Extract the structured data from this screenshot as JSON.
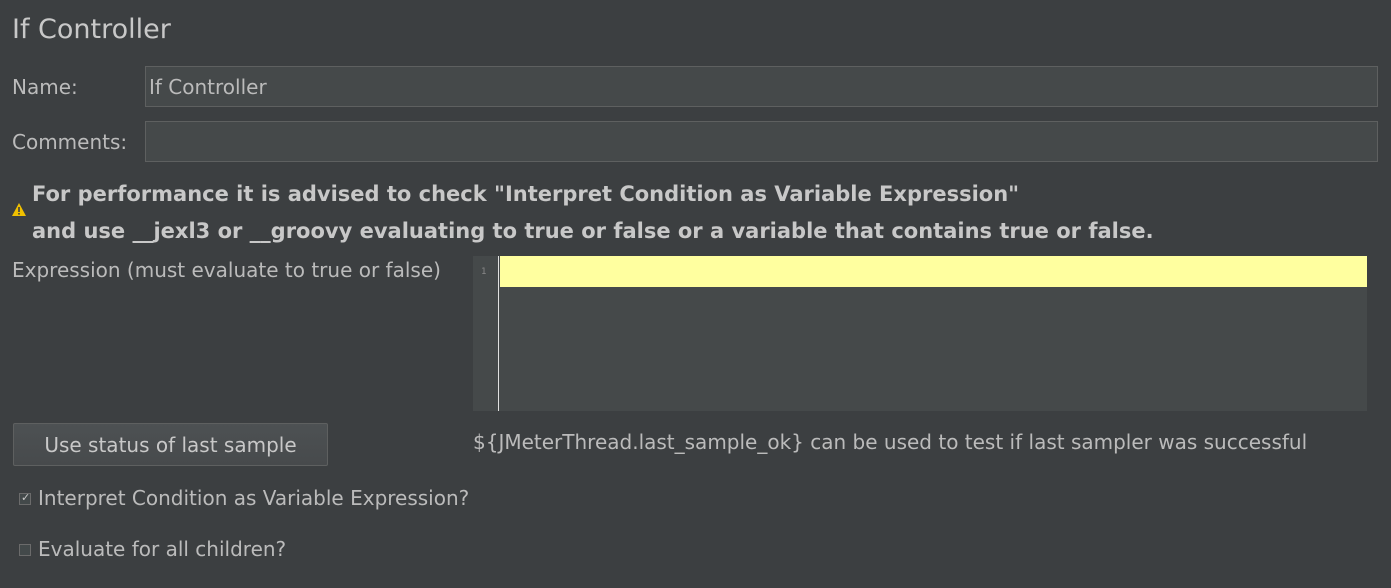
{
  "panel": {
    "title": "If Controller"
  },
  "name_field": {
    "label": "Name:",
    "value": "If Controller"
  },
  "comments_field": {
    "label": "Comments:",
    "value": ""
  },
  "warning": {
    "icon": "warning-icon",
    "line1": "For performance it is advised to check \"Interpret Condition as Variable Expression\"",
    "line2": "and use __jexl3 or __groovy evaluating to true or false or a variable that contains true or false."
  },
  "expression": {
    "label": "Expression (must evaluate to true or false)",
    "line_number": "1",
    "value": ""
  },
  "last_sample": {
    "button_label": "Use status of last sample",
    "hint": "${JMeterThread.last_sample_ok} can be used to test if last sampler was successful"
  },
  "options": [
    {
      "label": "Interpret Condition as Variable Expression?",
      "checked": true
    },
    {
      "label": "Evaluate for all children?",
      "checked": false
    }
  ],
  "colors": {
    "background": "#3c3f41",
    "field_background": "#45494a",
    "current_line_highlight": "#ffff9f",
    "warning_icon": "#f0c000"
  }
}
